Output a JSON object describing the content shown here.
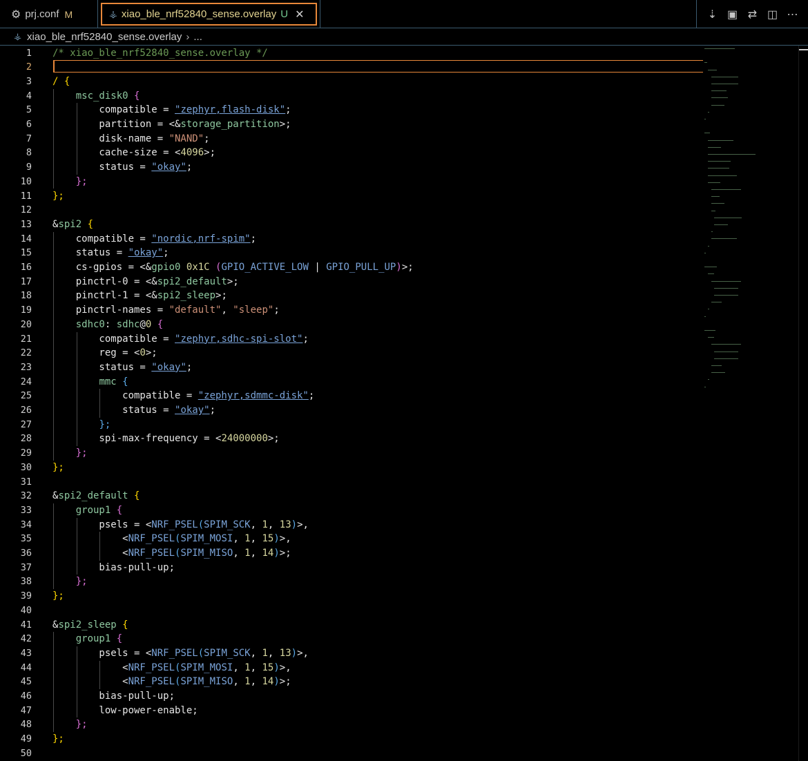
{
  "tabs": [
    {
      "label": "prj.conf",
      "status": "M"
    },
    {
      "label": "xiao_ble_nrf52840_sense.overlay",
      "status": "U"
    }
  ],
  "breadcrumb": {
    "file": "xiao_ble_nrf52840_sense.overlay",
    "rest": "..."
  },
  "editor": {
    "current_line": 2,
    "lines": [
      [
        [
          "cmt",
          "/* xiao_ble_nrf52840_sense.overlay */"
        ]
      ],
      [],
      [
        [
          "b1",
          "/"
        ],
        [
          "prop",
          " "
        ],
        [
          "b1",
          "{"
        ]
      ],
      [
        [
          "prop",
          "    "
        ],
        [
          "node",
          "msc_disk0"
        ],
        [
          "prop",
          " "
        ],
        [
          "b2",
          "{"
        ]
      ],
      [
        [
          "prop",
          "        compatible = "
        ],
        [
          "strl",
          "\"zephyr,flash-disk\""
        ],
        [
          "prop",
          ";"
        ]
      ],
      [
        [
          "prop",
          "        partition = <&"
        ],
        [
          "ref",
          "storage_partition"
        ],
        [
          "prop",
          ">;"
        ]
      ],
      [
        [
          "prop",
          "        disk-name = "
        ],
        [
          "str",
          "\"NAND\""
        ],
        [
          "prop",
          ";"
        ]
      ],
      [
        [
          "prop",
          "        cache-size = <"
        ],
        [
          "num",
          "4096"
        ],
        [
          "prop",
          ">;"
        ]
      ],
      [
        [
          "prop",
          "        status = "
        ],
        [
          "strl",
          "\"okay\""
        ],
        [
          "prop",
          ";"
        ]
      ],
      [
        [
          "prop",
          "    "
        ],
        [
          "b2",
          "};"
        ]
      ],
      [
        [
          "b1",
          "};"
        ]
      ],
      [],
      [
        [
          "prop",
          "&"
        ],
        [
          "ref",
          "spi2"
        ],
        [
          "prop",
          " "
        ],
        [
          "b1",
          "{"
        ]
      ],
      [
        [
          "prop",
          "    compatible = "
        ],
        [
          "strl",
          "\"nordic,nrf-spim\""
        ],
        [
          "prop",
          ";"
        ]
      ],
      [
        [
          "prop",
          "    status = "
        ],
        [
          "strl",
          "\"okay\""
        ],
        [
          "prop",
          ";"
        ]
      ],
      [
        [
          "prop",
          "    cs-gpios = <&"
        ],
        [
          "ref",
          "gpio0"
        ],
        [
          "prop",
          " "
        ],
        [
          "num",
          "0x1C"
        ],
        [
          "prop",
          " "
        ],
        [
          "b2",
          "("
        ],
        [
          "mac",
          "GPIO_ACTIVE_LOW"
        ],
        [
          "prop",
          " | "
        ],
        [
          "mac",
          "GPIO_PULL_UP"
        ],
        [
          "b2",
          ")"
        ],
        [
          "prop",
          ">;"
        ]
      ],
      [
        [
          "prop",
          "    pinctrl-0 = <&"
        ],
        [
          "ref",
          "spi2_default"
        ],
        [
          "prop",
          ">;"
        ]
      ],
      [
        [
          "prop",
          "    pinctrl-1 = <&"
        ],
        [
          "ref",
          "spi2_sleep"
        ],
        [
          "prop",
          ">;"
        ]
      ],
      [
        [
          "prop",
          "    pinctrl-names = "
        ],
        [
          "str",
          "\"default\""
        ],
        [
          "prop",
          ", "
        ],
        [
          "str",
          "\"sleep\""
        ],
        [
          "prop",
          ";"
        ]
      ],
      [
        [
          "prop",
          "    "
        ],
        [
          "node",
          "sdhc0"
        ],
        [
          "prop",
          ": "
        ],
        [
          "node",
          "sdhc"
        ],
        [
          "prop",
          "@"
        ],
        [
          "num",
          "0"
        ],
        [
          "prop",
          " "
        ],
        [
          "b2",
          "{"
        ]
      ],
      [
        [
          "prop",
          "        compatible = "
        ],
        [
          "strl",
          "\"zephyr,sdhc-spi-slot\""
        ],
        [
          "prop",
          ";"
        ]
      ],
      [
        [
          "prop",
          "        reg = <"
        ],
        [
          "num",
          "0"
        ],
        [
          "prop",
          ">;"
        ]
      ],
      [
        [
          "prop",
          "        status = "
        ],
        [
          "strl",
          "\"okay\""
        ],
        [
          "prop",
          ";"
        ]
      ],
      [
        [
          "prop",
          "        "
        ],
        [
          "node",
          "mmc"
        ],
        [
          "prop",
          " "
        ],
        [
          "b3",
          "{"
        ]
      ],
      [
        [
          "prop",
          "            compatible = "
        ],
        [
          "strl",
          "\"zephyr,sdmmc-disk\""
        ],
        [
          "prop",
          ";"
        ]
      ],
      [
        [
          "prop",
          "            status = "
        ],
        [
          "strl",
          "\"okay\""
        ],
        [
          "prop",
          ";"
        ]
      ],
      [
        [
          "prop",
          "        "
        ],
        [
          "b3",
          "};"
        ]
      ],
      [
        [
          "prop",
          "        spi-max-frequency = <"
        ],
        [
          "num",
          "24000000"
        ],
        [
          "prop",
          ">;"
        ]
      ],
      [
        [
          "prop",
          "    "
        ],
        [
          "b2",
          "};"
        ]
      ],
      [
        [
          "b1",
          "};"
        ]
      ],
      [],
      [
        [
          "prop",
          "&"
        ],
        [
          "ref",
          "spi2_default"
        ],
        [
          "prop",
          " "
        ],
        [
          "b1",
          "{"
        ]
      ],
      [
        [
          "prop",
          "    "
        ],
        [
          "node",
          "group1"
        ],
        [
          "prop",
          " "
        ],
        [
          "b2",
          "{"
        ]
      ],
      [
        [
          "prop",
          "        psels = <"
        ],
        [
          "mac",
          "NRF_PSEL"
        ],
        [
          "b3",
          "("
        ],
        [
          "mac",
          "SPIM_SCK"
        ],
        [
          "prop",
          ", "
        ],
        [
          "num",
          "1"
        ],
        [
          "prop",
          ", "
        ],
        [
          "num",
          "13"
        ],
        [
          "b3",
          ")"
        ],
        [
          "prop",
          ">,"
        ]
      ],
      [
        [
          "prop",
          "            <"
        ],
        [
          "mac",
          "NRF_PSEL"
        ],
        [
          "b3",
          "("
        ],
        [
          "mac",
          "SPIM_MOSI"
        ],
        [
          "prop",
          ", "
        ],
        [
          "num",
          "1"
        ],
        [
          "prop",
          ", "
        ],
        [
          "num",
          "15"
        ],
        [
          "b3",
          ")"
        ],
        [
          "prop",
          ">,"
        ]
      ],
      [
        [
          "prop",
          "            <"
        ],
        [
          "mac",
          "NRF_PSEL"
        ],
        [
          "b3",
          "("
        ],
        [
          "mac",
          "SPIM_MISO"
        ],
        [
          "prop",
          ", "
        ],
        [
          "num",
          "1"
        ],
        [
          "prop",
          ", "
        ],
        [
          "num",
          "14"
        ],
        [
          "b3",
          ")"
        ],
        [
          "prop",
          ">;"
        ]
      ],
      [
        [
          "prop",
          "        bias-pull-up;"
        ]
      ],
      [
        [
          "prop",
          "    "
        ],
        [
          "b2",
          "};"
        ]
      ],
      [
        [
          "b1",
          "};"
        ]
      ],
      [],
      [
        [
          "prop",
          "&"
        ],
        [
          "ref",
          "spi2_sleep"
        ],
        [
          "prop",
          " "
        ],
        [
          "b1",
          "{"
        ]
      ],
      [
        [
          "prop",
          "    "
        ],
        [
          "node",
          "group1"
        ],
        [
          "prop",
          " "
        ],
        [
          "b2",
          "{"
        ]
      ],
      [
        [
          "prop",
          "        psels = <"
        ],
        [
          "mac",
          "NRF_PSEL"
        ],
        [
          "b3",
          "("
        ],
        [
          "mac",
          "SPIM_SCK"
        ],
        [
          "prop",
          ", "
        ],
        [
          "num",
          "1"
        ],
        [
          "prop",
          ", "
        ],
        [
          "num",
          "13"
        ],
        [
          "b3",
          ")"
        ],
        [
          "prop",
          ">,"
        ]
      ],
      [
        [
          "prop",
          "            <"
        ],
        [
          "mac",
          "NRF_PSEL"
        ],
        [
          "b3",
          "("
        ],
        [
          "mac",
          "SPIM_MOSI"
        ],
        [
          "prop",
          ", "
        ],
        [
          "num",
          "1"
        ],
        [
          "prop",
          ", "
        ],
        [
          "num",
          "15"
        ],
        [
          "b3",
          ")"
        ],
        [
          "prop",
          ">,"
        ]
      ],
      [
        [
          "prop",
          "            <"
        ],
        [
          "mac",
          "NRF_PSEL"
        ],
        [
          "b3",
          "("
        ],
        [
          "mac",
          "SPIM_MISO"
        ],
        [
          "prop",
          ", "
        ],
        [
          "num",
          "1"
        ],
        [
          "prop",
          ", "
        ],
        [
          "num",
          "14"
        ],
        [
          "b3",
          ")"
        ],
        [
          "prop",
          ">;"
        ]
      ],
      [
        [
          "prop",
          "        bias-pull-up;"
        ]
      ],
      [
        [
          "prop",
          "        low-power-enable;"
        ]
      ],
      [
        [
          "prop",
          "    "
        ],
        [
          "b2",
          "};"
        ]
      ],
      [
        [
          "b1",
          "};"
        ]
      ],
      []
    ]
  },
  "icons": {
    "tab_prj": "gear-icon",
    "tab_overlay": "devicetree-file-icon",
    "close": "close-icon",
    "actions": [
      "download-diff-icon",
      "chip-icon",
      "compare-changes-icon",
      "split-editor-icon",
      "more-actions-icon"
    ]
  }
}
